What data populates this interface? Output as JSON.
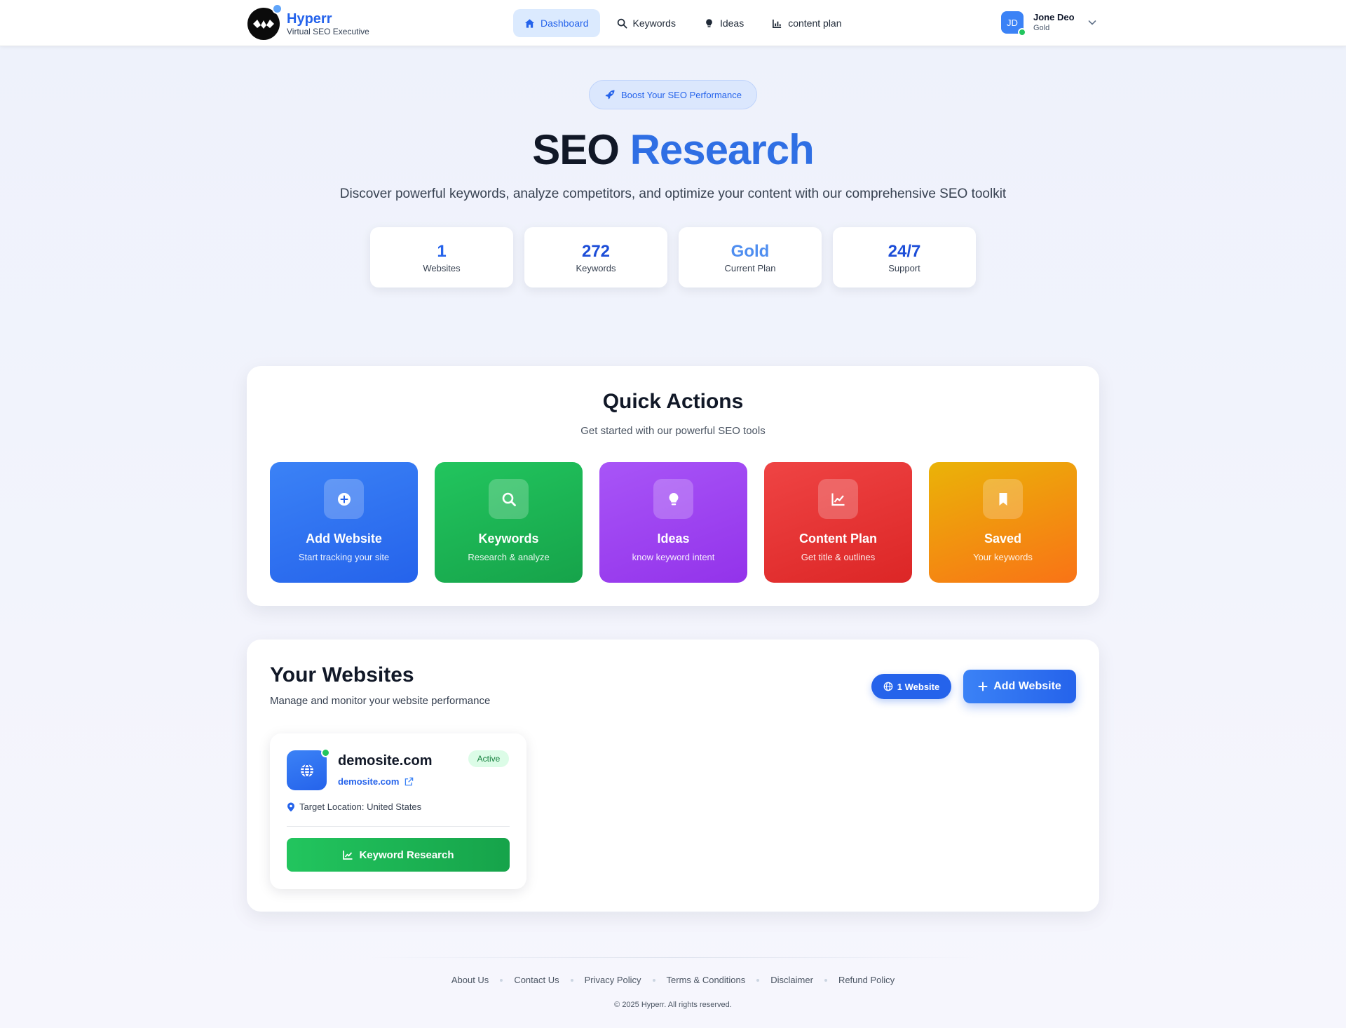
{
  "header": {
    "brand": {
      "name": "Hyperr",
      "tagline": "Virtual SEO Executive"
    },
    "nav": [
      {
        "label": "Dashboard",
        "icon": "home-icon",
        "active": true
      },
      {
        "label": "Keywords",
        "icon": "search-icon",
        "active": false
      },
      {
        "label": "Ideas",
        "icon": "lightbulb-icon",
        "active": false
      },
      {
        "label": "content plan",
        "icon": "chart-icon",
        "active": false
      }
    ],
    "user": {
      "initials": "JD",
      "name": "Jone Deo",
      "plan": "Gold"
    }
  },
  "hero": {
    "badge": "Boost Your SEO Performance",
    "title_part1": "SEO",
    "title_part2": "Research",
    "subtitle": "Discover powerful keywords, analyze competitors, and optimize your content with our comprehensive SEO toolkit",
    "stats": [
      {
        "value": "1",
        "label": "Websites"
      },
      {
        "value": "272",
        "label": "Keywords"
      },
      {
        "value": "Gold",
        "label": "Current Plan"
      },
      {
        "value": "24/7",
        "label": "Support"
      }
    ]
  },
  "quick_actions": {
    "title": "Quick Actions",
    "subtitle": "Get started with our powerful SEO tools",
    "tiles": [
      {
        "name": "Add Website",
        "desc": "Start tracking your site",
        "icon": "plus-circle-icon",
        "color": "#2563eb"
      },
      {
        "name": "Keywords",
        "desc": "Research & analyze",
        "icon": "search-icon",
        "color": "#16a34a"
      },
      {
        "name": "Ideas",
        "desc": "know keyword intent",
        "icon": "lightbulb-icon",
        "color": "#9333ea"
      },
      {
        "name": "Content Plan",
        "desc": "Get title & outlines",
        "icon": "chart-line-icon",
        "color": "#dc2626"
      },
      {
        "name": "Saved",
        "desc": "Your keywords",
        "icon": "bookmark-icon",
        "color": "#f59e0b"
      }
    ]
  },
  "websites": {
    "title": "Your Websites",
    "subtitle": "Manage and monitor your website performance",
    "count_label": "1 Website",
    "add_label": "Add Website",
    "items": [
      {
        "name": "demosite.com",
        "url": "demosite.com",
        "status": "Active",
        "location": "Target Location: United States",
        "action": "Keyword Research"
      }
    ]
  },
  "footer": {
    "links": [
      "About Us",
      "Contact Us",
      "Privacy Policy",
      "Terms & Conditions",
      "Disclaimer",
      "Refund Policy"
    ],
    "copyright": "© 2025 Hyperr. All rights reserved."
  }
}
